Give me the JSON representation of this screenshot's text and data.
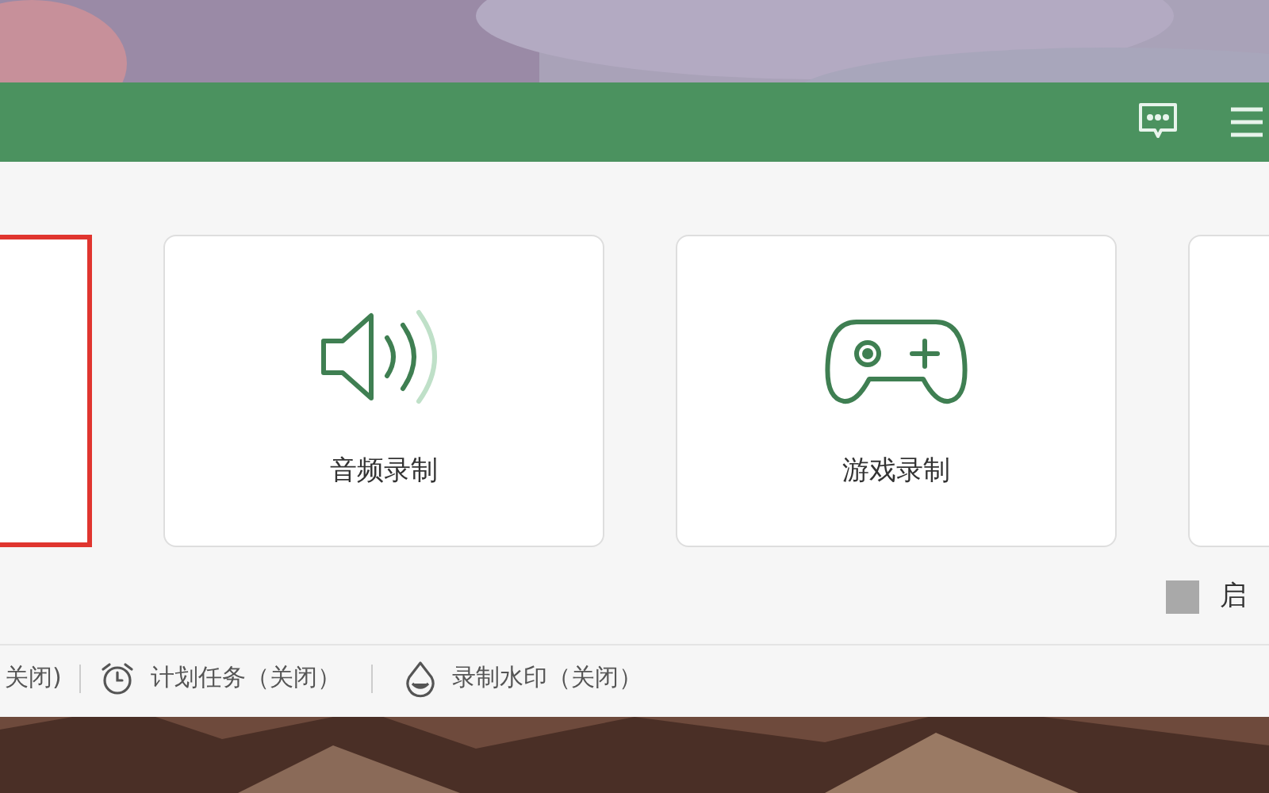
{
  "cards": [
    {
      "kind": "blank",
      "selected": true
    },
    {
      "kind": "audio",
      "label": "音频录制",
      "selected": false
    },
    {
      "kind": "game",
      "label": "游戏录制",
      "selected": false
    },
    {
      "kind": "blank",
      "selected": false
    }
  ],
  "option": {
    "label": "启",
    "checked": false
  },
  "status_bar": [
    {
      "kind": "plain",
      "text": "关闭)"
    },
    {
      "kind": "alarm",
      "text": "计划任务（关闭）"
    },
    {
      "kind": "drop",
      "text": "录制水印（关闭）"
    }
  ]
}
